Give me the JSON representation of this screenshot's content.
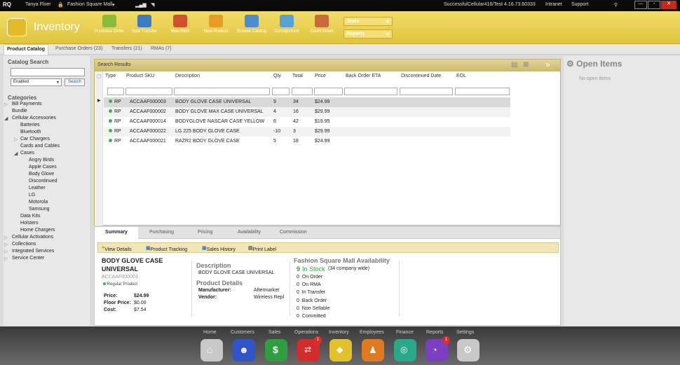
{
  "top": {
    "app": "RQ",
    "user": "Tanya Floer",
    "store": "Fashion Square Mall",
    "server": "SuccessfulCellular416/Test 4.16.73.60333",
    "intranet": "Intranet",
    "support": "Support"
  },
  "header": {
    "title": "Inventory",
    "tools": [
      "Purchase Order",
      "New Transfer",
      "New RMA",
      "New Product",
      "Browse Catalog",
      "Consignment",
      "Count Sheet"
    ],
    "tools_dd": "Tools",
    "reports_dd": "Reports"
  },
  "tabs": [
    "Product Catalog",
    "Purchase Orders (23)",
    "Transfers (21)",
    "RMAs (7)"
  ],
  "sidebar": {
    "search_title": "Catalog Search",
    "filter_value": "Enabled",
    "search_button": "Search",
    "categories_title": "Categories",
    "tree": [
      "Bill Payments",
      "Bundle",
      "Cellular Accessories",
      "Batteries",
      "Bluetooth",
      "Car Chargers",
      "Cards and Cables",
      "Cases",
      "Angry Birds",
      "Apple Cases",
      "Body Glove",
      "Discontinued",
      "Leather",
      "LG",
      "Motorola",
      "Samsung",
      "Data Kits",
      "Holsters",
      "Home Chargers",
      "Cellular Activations",
      "Collections",
      "Integrated Services",
      "Service Center"
    ]
  },
  "results": {
    "title": "Search Results",
    "columns": [
      "Type",
      "Product SKU",
      "Description",
      "Qty",
      "Total",
      "Price",
      "Back Order ETA",
      "Discontinued Date",
      "EOL"
    ],
    "rows": [
      {
        "type": "RP",
        "sku": "ACCAAF000003",
        "desc": "BODY GLOVE CASE UNIVERSAL",
        "qty": "9",
        "total": "34",
        "price": "$24.99"
      },
      {
        "type": "RP",
        "sku": "ACCAAF000002",
        "desc": "BODY GLOVE MAX CASE UNIVERSAL",
        "qty": "4",
        "total": "16",
        "price": "$29.99"
      },
      {
        "type": "RP",
        "sku": "ACCAAF000014",
        "desc": "BODYGLOVE NASCAR CASE YELLOW",
        "qty": "6",
        "total": "42",
        "price": "$19.95"
      },
      {
        "type": "RP",
        "sku": "ACCAAF000022",
        "desc": "LG 225 BODY GLOVE CASE",
        "qty": "-10",
        "total": "3",
        "price": "$29.99"
      },
      {
        "type": "RP",
        "sku": "ACCAAF000021",
        "desc": "RAZR2 BODY GLOVE CASE",
        "qty": "5",
        "total": "18",
        "price": "$24.99"
      }
    ]
  },
  "detail": {
    "tabs": [
      "Summary",
      "Purchasing",
      "Pricing",
      "Availability",
      "Commission"
    ],
    "actions": [
      "View Details",
      "Product Tracking",
      "Sales History",
      "Print Label"
    ],
    "name1": "BODY GLOVE CASE",
    "name2": "UNIVERSAL",
    "sku": "ACCAAF000003",
    "ptype": "Regular Product",
    "price_label": "Price:",
    "price": "$24.99",
    "floor_label": "Floor Price:",
    "floor": "$0.00",
    "cost_label": "Cost:",
    "cost": "$7.54",
    "desc_title": "Description",
    "desc": "BODY GLOVE CASE UNIVERSAL",
    "pd_title": "Product Details",
    "mfr_label": "Manufacturer:",
    "mfr": "Aftermarket",
    "vendor_label": "Vendor:",
    "vendor": "Wireless Repl",
    "avail_title": "Fashion Square Mall Availability",
    "instock_n": "9",
    "instock": "In Stock",
    "company": "(34 company wide)",
    "stock": [
      [
        "0",
        "On Order"
      ],
      [
        "0",
        "On RMA"
      ],
      [
        "0",
        "In Transfer"
      ],
      [
        "0",
        "Back Order"
      ],
      [
        "0",
        "Non Sellable"
      ],
      [
        "0",
        "Committed"
      ]
    ]
  },
  "open_items": {
    "title": "Open Items",
    "empty": "No open items"
  },
  "dock": [
    {
      "label": "Home",
      "color": "#bfbfbf"
    },
    {
      "label": "Customers",
      "color": "#2f55c8"
    },
    {
      "label": "Sales",
      "color": "#2e9e3e"
    },
    {
      "label": "Operations",
      "color": "#d42b2b",
      "badge": "1"
    },
    {
      "label": "Inventory",
      "color": "#e2c12a"
    },
    {
      "label": "Employees",
      "color": "#e07a20"
    },
    {
      "label": "Finance",
      "color": "#2aa88a"
    },
    {
      "label": "Reports",
      "color": "#7a3ec0",
      "badge": "1"
    },
    {
      "label": "Settings",
      "color": "#bfbfbf"
    }
  ]
}
